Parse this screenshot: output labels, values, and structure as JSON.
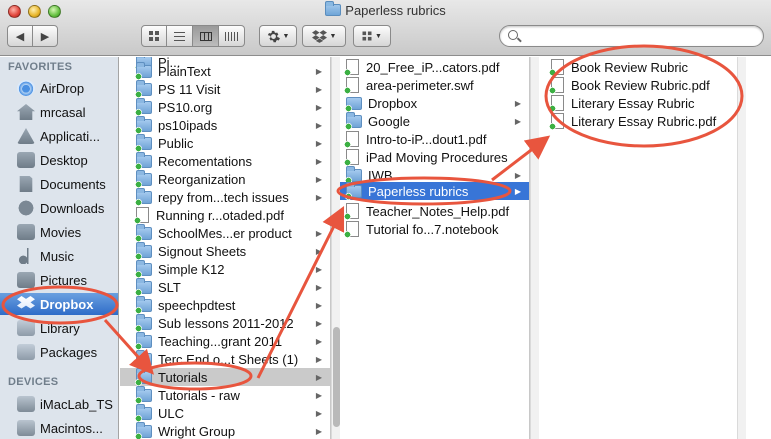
{
  "window": {
    "title": "Paperless rubrics"
  },
  "toolbar": {
    "back_label": "◀",
    "forward_label": "▶",
    "action_icon": "gear-icon",
    "dropbox_icon": "dropbox-icon",
    "arrange_icon": "arrange-icon",
    "search_placeholder": ""
  },
  "sidebar": {
    "favorites_header": "FAVORITES",
    "devices_header": "DEVICES",
    "items": [
      {
        "label": "AirDrop",
        "icon": "airdrop-icon"
      },
      {
        "label": "mrcasal",
        "icon": "home-icon"
      },
      {
        "label": "Applicati...",
        "icon": "applications-icon"
      },
      {
        "label": "Desktop",
        "icon": "desktop-icon"
      },
      {
        "label": "Documents",
        "icon": "documents-icon"
      },
      {
        "label": "Downloads",
        "icon": "downloads-icon"
      },
      {
        "label": "Movies",
        "icon": "movies-icon"
      },
      {
        "label": "Music",
        "icon": "music-icon"
      },
      {
        "label": "Pictures",
        "icon": "pictures-icon"
      },
      {
        "label": "Dropbox",
        "icon": "dropbox-icon",
        "selected": true
      },
      {
        "label": "Library",
        "icon": "library-icon"
      },
      {
        "label": "Packages",
        "icon": "packages-icon"
      }
    ],
    "devices": [
      {
        "label": "iMacLab_TS",
        "icon": "computer-icon"
      },
      {
        "label": "Macintos...",
        "icon": "hard-drive-icon"
      }
    ]
  },
  "column1": {
    "items": [
      {
        "label": "PlainText",
        "kind": "folder"
      },
      {
        "label": "PS 11 Visit",
        "kind": "folder"
      },
      {
        "label": "PS10.org",
        "kind": "folder"
      },
      {
        "label": "ps10ipads",
        "kind": "folder"
      },
      {
        "label": "Public",
        "kind": "folder"
      },
      {
        "label": "Recomentations",
        "kind": "folder"
      },
      {
        "label": "Reorganization",
        "kind": "folder"
      },
      {
        "label": "repy from...tech issues",
        "kind": "folder"
      },
      {
        "label": "Running r...otaded.pdf",
        "kind": "file"
      },
      {
        "label": "SchoolMes...er product",
        "kind": "folder"
      },
      {
        "label": "Signout Sheets",
        "kind": "folder"
      },
      {
        "label": "Simple K12",
        "kind": "folder"
      },
      {
        "label": "SLT",
        "kind": "folder"
      },
      {
        "label": "speechpdtest",
        "kind": "folder"
      },
      {
        "label": "Sub lessons 2011-2012",
        "kind": "folder"
      },
      {
        "label": "Teaching...grant 2011",
        "kind": "folder"
      },
      {
        "label": "Terc End o...t Sheets (1)",
        "kind": "folder"
      },
      {
        "label": "Tutorials",
        "kind": "folder",
        "selected": true
      },
      {
        "label": "Tutorials - raw",
        "kind": "folder"
      },
      {
        "label": "ULC",
        "kind": "folder"
      },
      {
        "label": "Wright Group",
        "kind": "folder"
      }
    ]
  },
  "column2": {
    "items": [
      {
        "label": "20_Free_iP...cators.pdf",
        "kind": "file"
      },
      {
        "label": "area-perimeter.swf",
        "kind": "file"
      },
      {
        "label": "Dropbox",
        "kind": "folder"
      },
      {
        "label": "Google",
        "kind": "folder"
      },
      {
        "label": "Intro-to-iP...dout1.pdf",
        "kind": "file"
      },
      {
        "label": "iPad Moving Procedures",
        "kind": "file"
      },
      {
        "label": "IWB",
        "kind": "folder"
      },
      {
        "label": "Paperless rubrics",
        "kind": "folder",
        "selected": true
      },
      {
        "label": "Teacher_Notes_Help.pdf",
        "kind": "file"
      },
      {
        "label": "Tutorial fo...7.notebook",
        "kind": "file"
      }
    ]
  },
  "column3": {
    "items": [
      {
        "label": "Book Review Rubric",
        "kind": "file"
      },
      {
        "label": "Book Review Rubric.pdf",
        "kind": "file"
      },
      {
        "label": "Literary Essay Rubric",
        "kind": "file"
      },
      {
        "label": "Literary Essay Rubric.pdf",
        "kind": "file"
      }
    ]
  },
  "annotations": {
    "color": "#e8553e"
  },
  "colors": {
    "selection": "#3875d7",
    "sidebar_bg": "#dde4ec",
    "sidebar_header": "#707e8b"
  }
}
